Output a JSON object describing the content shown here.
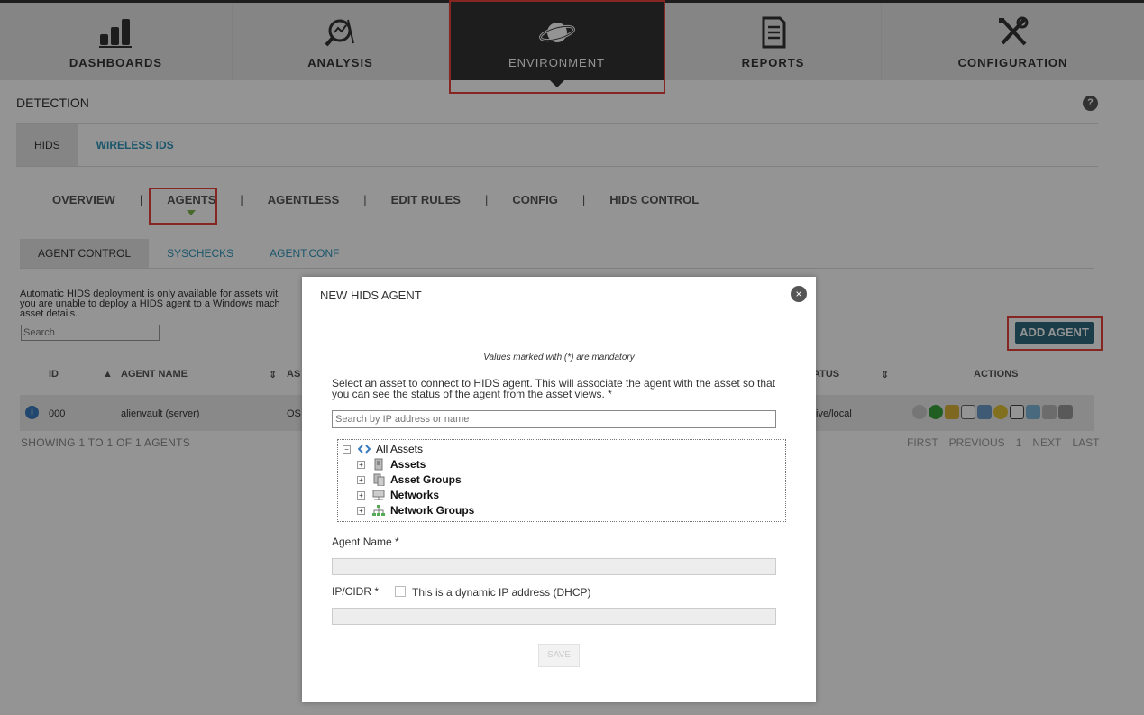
{
  "nav": {
    "items": [
      {
        "label": "DASHBOARDS",
        "icon": "bar-chart-icon"
      },
      {
        "label": "ANALYSIS",
        "icon": "magnifier-chart-icon"
      },
      {
        "label": "ENVIRONMENT",
        "icon": "planet-icon"
      },
      {
        "label": "REPORTS",
        "icon": "report-icon"
      },
      {
        "label": "CONFIGURATION",
        "icon": "tools-icon"
      }
    ]
  },
  "section": {
    "title": "DETECTION",
    "help": "?"
  },
  "tabs": [
    {
      "label": "HIDS"
    },
    {
      "label": "WIRELESS IDS"
    }
  ],
  "subnav": [
    "OVERVIEW",
    "AGENTS",
    "AGENTLESS",
    "EDIT RULES",
    "CONFIG",
    "HIDS CONTROL"
  ],
  "subnav_sep": "|",
  "subtabs": [
    {
      "label": "AGENT CONTROL"
    },
    {
      "label": "SYSCHECKS"
    },
    {
      "label": "AGENT.CONF"
    }
  ],
  "notice": [
    "Automatic HIDS deployment is only available for assets wit",
    "you are unable to deploy a HIDS agent to a Windows mach",
    "asset details."
  ],
  "search_placeholder": "Search",
  "add_agent_label": "ADD AGENT",
  "table": {
    "headers": {
      "id": "ID",
      "name": "AGENT NAME",
      "asset": "AS",
      "status": "ATUS",
      "actions": "ACTIONS"
    },
    "row": {
      "info": "i",
      "id": "000",
      "name": "alienvault (server)",
      "asset": "OS",
      "status": "tive/local"
    }
  },
  "showing": "SHOWING 1 TO 1 OF 1 AGENTS",
  "pager": {
    "first": "FIRST",
    "previous": "PREVIOUS",
    "page": "1",
    "next": "NEXT",
    "last": "LAST"
  },
  "modal": {
    "title": "NEW HIDS AGENT",
    "close": "×",
    "mandatory_note": "Values marked with (*) are mandatory",
    "description": "Select an asset to connect to HIDS agent. This will associate the agent with the asset so that you can see the status of the agent from the asset views. *",
    "asset_search_placeholder": "Search by IP address or name",
    "tree": {
      "root": "All Assets",
      "children": [
        "Assets",
        "Asset Groups",
        "Networks",
        "Network Groups"
      ]
    },
    "agent_name_label": "Agent Name *",
    "ip_label": "IP/CIDR *",
    "dhcp_label": "This is a dynamic IP address (DHCP)",
    "save_label": "SAVE"
  },
  "colors": {
    "accent": "#2e95b8",
    "highlight": "#e5433b",
    "button": "#2d6a7f"
  }
}
